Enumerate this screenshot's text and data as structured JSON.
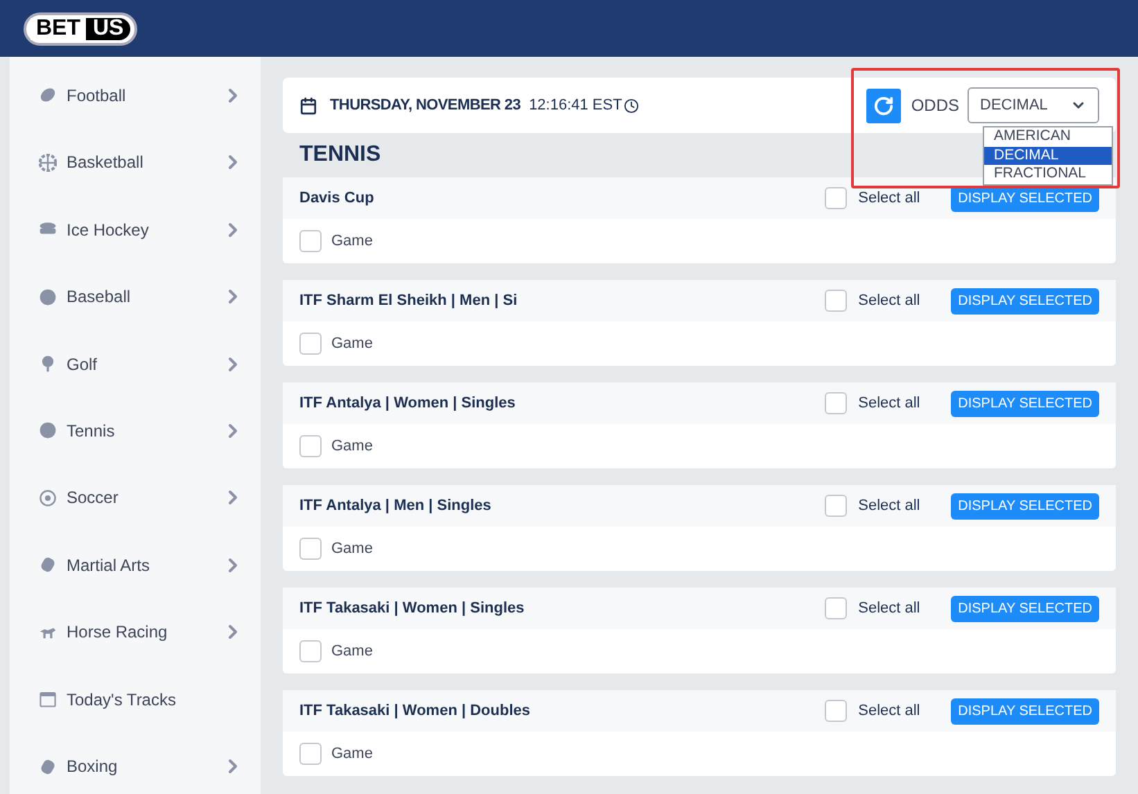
{
  "logo": {
    "left": "BET",
    "right": "US"
  },
  "sidebar": {
    "items": [
      {
        "label": "Football",
        "has_arrow": true
      },
      {
        "label": "Basketball",
        "has_arrow": true
      },
      {
        "label": "Ice Hockey",
        "has_arrow": true
      },
      {
        "label": "Baseball",
        "has_arrow": true
      },
      {
        "label": "Golf",
        "has_arrow": true
      },
      {
        "label": "Tennis",
        "has_arrow": true
      },
      {
        "label": "Soccer",
        "has_arrow": true
      },
      {
        "label": "Martial Arts",
        "has_arrow": true
      },
      {
        "label": "Horse Racing",
        "has_arrow": true
      },
      {
        "label": "Today's Tracks",
        "has_arrow": false
      },
      {
        "label": "Boxing",
        "has_arrow": true
      }
    ]
  },
  "date_bar": {
    "date": "THURSDAY, NOVEMBER 23",
    "time": "12:16:41 EST",
    "odds_label": "ODDS",
    "odds_value": "DECIMAL",
    "odds_options": [
      {
        "label": "AMERICAN",
        "selected": false
      },
      {
        "label": "DECIMAL",
        "selected": true
      },
      {
        "label": "FRACTIONAL",
        "selected": false
      }
    ],
    "highlighted": true
  },
  "section_title": "TENNIS",
  "leagues": [
    {
      "name": "Davis Cup",
      "select_all": "Select all",
      "all_checked": false,
      "button": "DISPLAY SELECTED",
      "game": "Game",
      "game_checked": false
    },
    {
      "name": "ITF Sharm El Sheikh | Men | Si",
      "select_all": "Select all",
      "all_checked": false,
      "button": "DISPLAY SELECTED",
      "game": "Game",
      "game_checked": false
    },
    {
      "name": "ITF Antalya | Women | Singles",
      "select_all": "Select all",
      "all_checked": false,
      "button": "DISPLAY SELECTED",
      "game": "Game",
      "game_checked": false
    },
    {
      "name": "ITF Antalya | Men | Singles",
      "select_all": "Select all",
      "all_checked": false,
      "button": "DISPLAY SELECTED",
      "game": "Game",
      "game_checked": false
    },
    {
      "name": "ITF Takasaki | Women | Singles",
      "select_all": "Select all",
      "all_checked": false,
      "button": "DISPLAY SELECTED",
      "game": "Game",
      "game_checked": false
    },
    {
      "name": "ITF Takasaki | Women | Doubles",
      "select_all": "Select all",
      "all_checked": false,
      "button": "DISPLAY SELECTED",
      "game": "Game",
      "game_checked": false
    }
  ]
}
